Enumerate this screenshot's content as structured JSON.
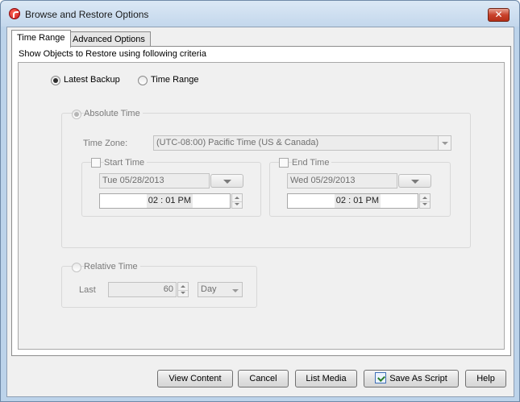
{
  "window": {
    "title": "Browse and Restore Options",
    "close_label": "✕"
  },
  "tabs": [
    {
      "label": "Time Range",
      "active": true
    },
    {
      "label": "Advanced Options",
      "active": false
    }
  ],
  "criteria_label": "Show Objects to Restore using following criteria",
  "mode": {
    "latest_backup_label": "Latest Backup",
    "time_range_label": "Time Range",
    "selected": "Latest Backup"
  },
  "absolute_time": {
    "label": "Absolute Time",
    "timezone_label": "Time Zone:",
    "timezone_value": "(UTC-08:00) Pacific Time (US & Canada)",
    "start": {
      "label": "Start Time",
      "date": "Tue 05/28/2013",
      "time": "02 : 01 PM"
    },
    "end": {
      "label": "End Time",
      "date": "Wed 05/29/2013",
      "time": "02 : 01 PM"
    }
  },
  "relative_time": {
    "label": "Relative Time",
    "last_label": "Last",
    "value": "60",
    "unit": "Day"
  },
  "buttons": {
    "view_content": "View Content",
    "cancel": "Cancel",
    "list_media": "List Media",
    "save_as_script": "Save As Script",
    "help": "Help"
  },
  "icons": {
    "app": "commvault-app-icon",
    "script": "save-script-icon"
  }
}
